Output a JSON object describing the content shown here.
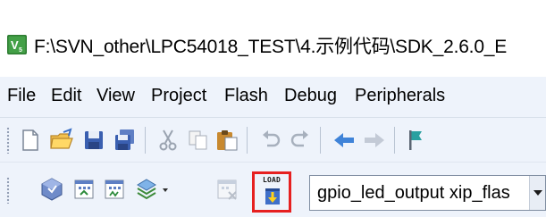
{
  "window": {
    "title": "F:\\SVN_other\\LPC54018_TEST\\4.示例代码\\SDK_2.6.0_E",
    "icon": "keil-uvision-app-icon"
  },
  "menubar": {
    "items": [
      "File",
      "Edit",
      "View",
      "Project",
      "Flash",
      "Debug",
      "Peripherals"
    ]
  },
  "toolbar_row1": {
    "buttons": [
      "new-file-icon",
      "open-folder-icon",
      "save-icon",
      "save-all-icon",
      "cut-icon",
      "copy-icon",
      "paste-icon",
      "undo-icon",
      "redo-icon",
      "navigate-back-icon",
      "navigate-forward-icon",
      "bookmark-flag-icon"
    ]
  },
  "toolbar_row2": {
    "buttons": [
      "translate-icon",
      "build-icon",
      "rebuild-icon",
      "batch-build-icon",
      "stop-build-icon"
    ],
    "load_button": {
      "label": "LOAD",
      "icon": "download-load-icon",
      "highlight_color": "#e62020"
    },
    "target_select": {
      "value": "gpio_led_output xip_flas"
    }
  }
}
